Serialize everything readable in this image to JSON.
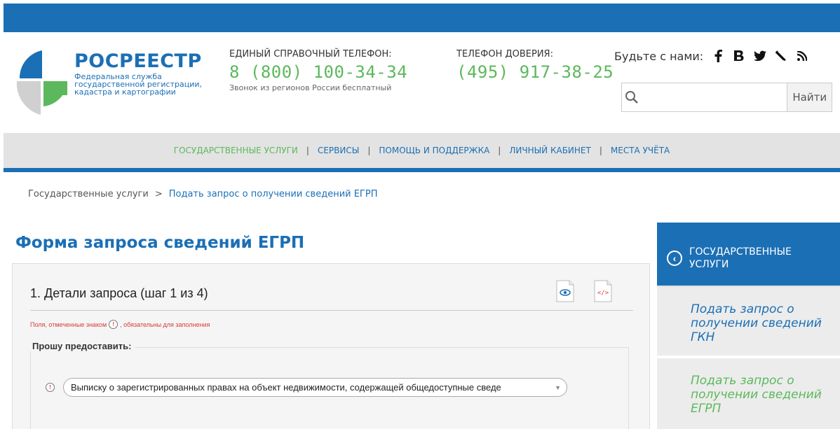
{
  "header": {
    "logo": {
      "name": "РОСРЕЕСТР",
      "subtitle": "Федеральная служба государственной регистрации, кадастра и картографии"
    },
    "hotline": {
      "label": "ЕДИНЫЙ СПРАВОЧНЫЙ ТЕЛЕФОН:",
      "number": "8 (800) 100-34-34",
      "note": "Звонок из регионов России бесплатный"
    },
    "trust_line": {
      "label": "ТЕЛЕФОН ДОВЕРИЯ:",
      "number": "(495) 917-38-25"
    },
    "social": {
      "label": "Будьте с нами:",
      "icons": [
        "facebook-icon",
        "vk-icon",
        "twitter-icon",
        "livejournal-icon",
        "rss-icon"
      ]
    },
    "search": {
      "placeholder": "",
      "button_label": "Найти"
    }
  },
  "nav": {
    "items": [
      {
        "label": "ГОСУДАРСТВЕННЫЕ УСЛУГИ",
        "active": true
      },
      {
        "label": "СЕРВИСЫ",
        "active": false
      },
      {
        "label": "ПОМОЩЬ И ПОДДЕРЖКА",
        "active": false
      },
      {
        "label": "ЛИЧНЫЙ КАБИНЕТ",
        "active": false
      },
      {
        "label": "МЕСТА УЧЁТА",
        "active": false
      }
    ],
    "separator": "|"
  },
  "breadcrumb": {
    "root": "Государственные услуги",
    "separator": ">",
    "current": "Подать запрос о получении сведений ЕГРП"
  },
  "main": {
    "title": "Форма запроса сведений ЕГРП",
    "form": {
      "step_heading": "1. Детали запроса (шаг 1 из 4)",
      "required_note_before": "Поля, отмеченные знаком",
      "required_note_after": ", обязательны для заполнения",
      "required_mark": "!",
      "legend": "Прошу предоставить:",
      "select_value": "Выписку о зарегистрированных правах на объект недвижимости, содержащей общедоступные сведе"
    }
  },
  "sidebar": {
    "heading": "ГОСУДАРСТВЕННЫЕ УСЛУГИ",
    "items": [
      {
        "label": "Подать запрос о получении сведений ГКН"
      },
      {
        "label": "Подать запрос о получении сведений ЕГРП"
      }
    ]
  },
  "colors": {
    "brand_blue": "#1b6fb5",
    "brand_green": "#5cb85c",
    "required_red": "#d93a3a"
  }
}
